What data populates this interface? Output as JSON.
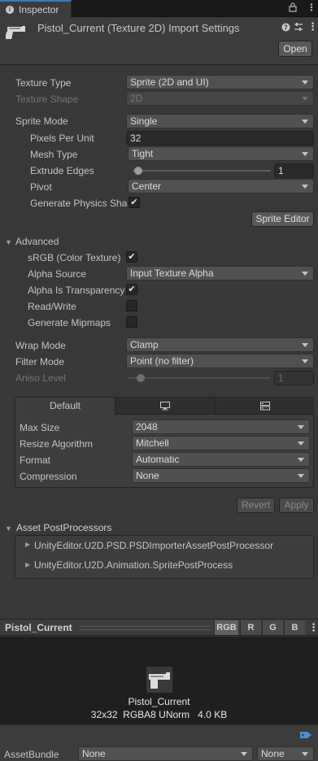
{
  "tab": {
    "icon": "info-icon",
    "label": "Inspector"
  },
  "header": {
    "title": "Pistol_Current (Texture 2D) Import Settings",
    "open_label": "Open"
  },
  "fields": {
    "texture_type": {
      "label": "Texture Type",
      "value": "Sprite (2D and UI)"
    },
    "texture_shape": {
      "label": "Texture Shape",
      "value": "2D"
    },
    "sprite_mode": {
      "label": "Sprite Mode",
      "value": "Single"
    },
    "pixels_per_unit": {
      "label": "Pixels Per Unit",
      "value": "32"
    },
    "mesh_type": {
      "label": "Mesh Type",
      "value": "Tight"
    },
    "extrude_edges": {
      "label": "Extrude Edges",
      "value": "1",
      "slider_fraction": 0.02
    },
    "pivot": {
      "label": "Pivot",
      "value": "Center"
    },
    "generate_physics_shape": {
      "label": "Generate Physics Shape",
      "checked": true
    },
    "sprite_editor_label": "Sprite Editor"
  },
  "advanced": {
    "title": "Advanced",
    "srgb": {
      "label": "sRGB (Color Texture)",
      "checked": true
    },
    "alpha_source": {
      "label": "Alpha Source",
      "value": "Input Texture Alpha"
    },
    "alpha_is_transparency": {
      "label": "Alpha Is Transparency",
      "checked": true
    },
    "read_write": {
      "label": "Read/Write",
      "checked": false
    },
    "generate_mipmaps": {
      "label": "Generate Mipmaps",
      "checked": false
    }
  },
  "wrap_mode": {
    "label": "Wrap Mode",
    "value": "Clamp"
  },
  "filter_mode": {
    "label": "Filter Mode",
    "value": "Point (no filter)"
  },
  "aniso_level": {
    "label": "Aniso Level",
    "value": "1",
    "slider_fraction": 0.06
  },
  "platform": {
    "tabs": [
      {
        "label": "Default",
        "icon": ""
      },
      {
        "label": "",
        "icon": "monitor-icon"
      },
      {
        "label": "",
        "icon": "server-icon"
      }
    ],
    "max_size": {
      "label": "Max Size",
      "value": "2048"
    },
    "resize_algorithm": {
      "label": "Resize Algorithm",
      "value": "Mitchell"
    },
    "format": {
      "label": "Format",
      "value": "Automatic"
    },
    "compression": {
      "label": "Compression",
      "value": "None"
    }
  },
  "buttons": {
    "revert": "Revert",
    "apply": "Apply"
  },
  "postprocessors": {
    "title": "Asset PostProcessors",
    "items": [
      "UnityEditor.U2D.PSD.PSDImporterAssetPostProcessor",
      "UnityEditor.U2D.Animation.SpritePostProcess"
    ]
  },
  "preview": {
    "title": "Pistol_Current",
    "channels": [
      "RGB",
      "R",
      "G",
      "B"
    ],
    "name": "Pistol_Current",
    "info": "32x32  RGBA8 UNorm   4.0 KB"
  },
  "asset_bundle": {
    "label": "AssetBundle",
    "name": "None",
    "variant": "None"
  }
}
